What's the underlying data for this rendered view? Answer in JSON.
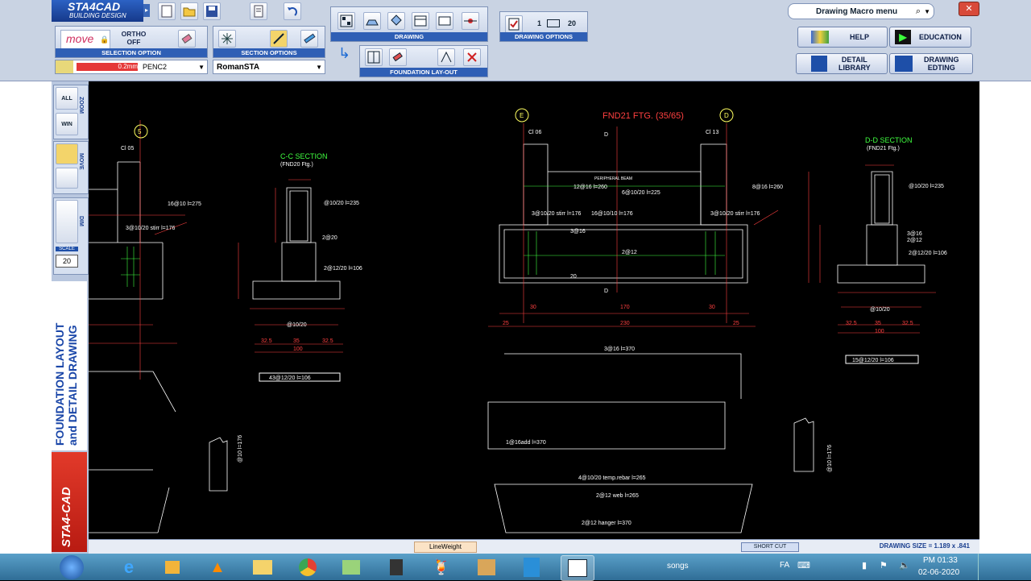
{
  "app": {
    "logo_title": "STA4CAD",
    "logo_sub": "BUILDING DESIGN"
  },
  "toolbar": {
    "move_label": "move",
    "ortho_line1": "ORTHO",
    "ortho_line2": "OFF",
    "selection_caption": "SELECTION OPTION",
    "section_caption": "SECTION OPTIONS",
    "drawing_caption": "DRAWING",
    "drawing_options_caption": "DRAWING OPTIONS",
    "drawing_options_value1": "1",
    "drawing_options_value2": "20",
    "foundation_caption": "FOUNDATION  LAY-OUT",
    "pen_width": "0.2mm",
    "pen_name": "PENC2",
    "font_name": "RomanSTA",
    "macro_menu": "Drawing Macro menu",
    "help": "HELP",
    "education": "EDUCATION",
    "detail_library_1": "DETAIL",
    "detail_library_2": "LIBRARY",
    "drawing_editing_1": "DRAWING",
    "drawing_editing_2": "EDTING"
  },
  "leftbar": {
    "zoom_all": "ALL",
    "zoom_win": "WIN",
    "zoom_label": "ZOOM",
    "move_label": "MOVE",
    "dim_label": "DIM",
    "scale_label": "SCALE",
    "scale_value": "20",
    "vertical_title_1": "FOUNDATION LAYOUT",
    "vertical_title_2": "and DETAIL DRAWING",
    "brand": "STA4-CAD"
  },
  "drawing": {
    "title_main": "FND21      FTG.      (35/65)",
    "axis_e": "E",
    "axis_d": "D",
    "axis_5": "5",
    "cc_section": "C-C SECTION",
    "cc_sub": "(FND20 Ftg.)",
    "dd_section": "D-D SECTION",
    "dd_sub": "(FND21 Ftg.)",
    "c105": "Cl 05",
    "c106": "Cl 06",
    "c113": "Cl 13",
    "peripheral_beam": "PERIPHERAL BEAM",
    "rebar_12": "12@16 l=260",
    "rebar_8": "8@16 l=260",
    "rebar_6": "6@10/20 l=225",
    "rebar_16": "16@10/10 l=176",
    "rebar_3a": "3@10/20 stirr l=176",
    "rebar_3b": "3@10/20 stirr l=176",
    "rebar_316": "3@16",
    "rebar_212": "2@12",
    "rebar_20": "20",
    "dim_30a": "30",
    "dim_170": "170",
    "dim_30b": "30",
    "dim_25a": "25",
    "dim_230": "230",
    "dim_25b": "25",
    "dd_cont": "@10/20 l=235",
    "dd_316": "3@16",
    "dd_212": "2@12",
    "dd_212b": "2@12/20 l=106",
    "dd_fi": "@10/20",
    "dd_325a": "32.5",
    "dd_35": "35",
    "dd_325b": "32.5",
    "dd_100": "100",
    "dd_bar": "15@12/20 l=106",
    "cc_cont": "@10/20 l=235",
    "cc_220": "2@20",
    "cc_212": "2@12/20 l=106",
    "cc_fi": "@10/20",
    "cc_325a": "32.5",
    "cc_35": "35",
    "cc_325b": "32.5",
    "cc_100": "100",
    "cc_bar": "43@12/20 l=106",
    "left_rebar1": "16@10 l=275",
    "left_rebar2": "3@10/20 stirr l=176",
    "bar_top": "3@16 l=370",
    "bar_bot": "1@16add l=370",
    "bar_temp": "4@10/20 temp.rebar l=265",
    "bar_web": "2@12   web   l=265",
    "bar_hanger": "2@12   hanger   l=370",
    "bar_v1": "@10 l=176",
    "bar_v2": "@10 l=176"
  },
  "status": {
    "lineweight": "LineWeight",
    "shortcut": "SHORT CUT",
    "drawing_size": "DRAWING SIZE = 1.189 x .841"
  },
  "taskbar": {
    "songs": "songs",
    "lang": "FA",
    "time": "PM 01:33",
    "date": "02-06-2020"
  },
  "colors": {
    "toolbar_blue": "#2f5fb5",
    "cad_red": "#ff4040",
    "cad_green": "#40ff40",
    "cad_white": "#ffffff"
  }
}
